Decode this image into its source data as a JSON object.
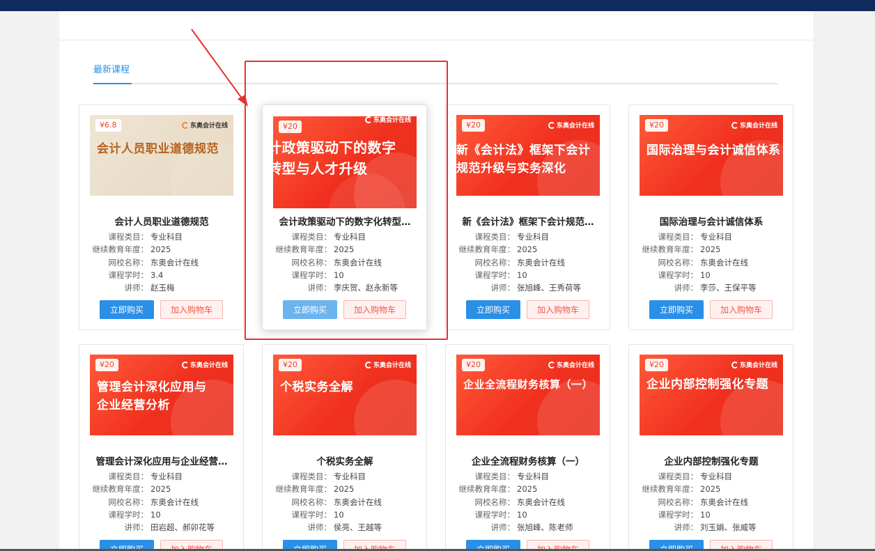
{
  "tab": {
    "label": "最新课程"
  },
  "labels": {
    "category": "课程类目：",
    "year": "继续教育年度：",
    "school": "网校名称：",
    "hours": "课程学时：",
    "lecturer": "讲师："
  },
  "buttons": {
    "buy": "立即购买",
    "cart": "加入购物车"
  },
  "brand": "东奥会计在线",
  "colors": {
    "accent": "#2a8fe6",
    "header": "#0e2b5c",
    "highlight": "#e8312c",
    "thumb_red": "#f0301e"
  },
  "courses": [
    {
      "price": "¥6.8",
      "thumb_text": "会计人员职业道德规范",
      "title": "会计人员职业道德规范",
      "category": "专业科目",
      "year": "2025",
      "school": "东奥会计在线",
      "hours": "3.4",
      "lecturer": "赵玉梅"
    },
    {
      "price": "¥20",
      "thumb_text": "计政策驱动下的数字\n转型与人才升级",
      "title": "会计政策驱动下的数字化转型…",
      "category": "专业科目",
      "year": "2025",
      "school": "东奥会计在线",
      "hours": "10",
      "lecturer": "李庆贺、赵永新等"
    },
    {
      "price": "¥20",
      "thumb_text": "新《会计法》框架下会计\n规范升级与实务深化",
      "title": "新《会计法》框架下会计规范…",
      "category": "专业科目",
      "year": "2025",
      "school": "东奥会计在线",
      "hours": "10",
      "lecturer": "张旭峰、王秀荷等"
    },
    {
      "price": "¥20",
      "thumb_text": "国际治理与会计诚信体系",
      "title": "国际治理与会计诚信体系",
      "category": "专业科目",
      "year": "2025",
      "school": "东奥会计在线",
      "hours": "10",
      "lecturer": "李莎、王保平等"
    },
    {
      "price": "¥20",
      "thumb_text": "管理会计深化应用与\n企业经营分析",
      "title": "管理会计深化应用与企业经营…",
      "category": "专业科目",
      "year": "2025",
      "school": "东奥会计在线",
      "hours": "10",
      "lecturer": "田岩超、郝卯花等"
    },
    {
      "price": "¥20",
      "thumb_text": "个税实务全解",
      "title": "个税实务全解",
      "category": "专业科目",
      "year": "2025",
      "school": "东奥会计在线",
      "hours": "10",
      "lecturer": "侯亮、王越等"
    },
    {
      "price": "¥20",
      "thumb_text": "企业全流程财务核算（一）",
      "title": "企业全流程财务核算（一）",
      "category": "专业科目",
      "year": "2025",
      "school": "东奥会计在线",
      "hours": "10",
      "lecturer": "张旭峰、陈老师"
    },
    {
      "price": "¥20",
      "thumb_text": "企业内部控制强化专题",
      "title": "企业内部控制强化专题",
      "category": "专业科目",
      "year": "2025",
      "school": "东奥会计在线",
      "hours": "10",
      "lecturer": "刘玉娟、张威等"
    }
  ]
}
